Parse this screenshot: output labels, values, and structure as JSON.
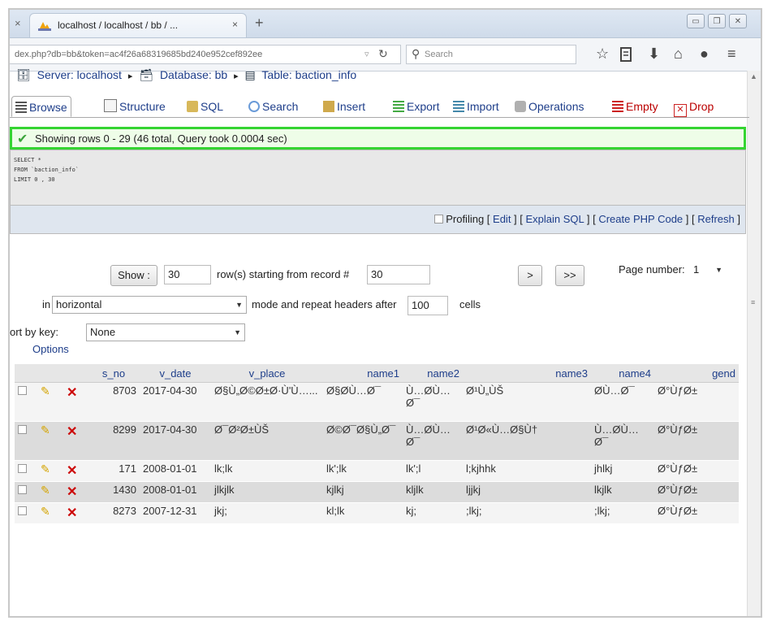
{
  "browser": {
    "prev_tab_close": "×",
    "tab_title": "localhost / localhost / bb / ...",
    "tab_close": "×",
    "new_tab": "+",
    "url": "dex.php?db=bb&token=ac4f26a68319685bd240e952cef892ee",
    "search_placeholder": "Search",
    "win_min": "▭",
    "win_max": "❐",
    "win_close": "✕"
  },
  "breadcrumb": {
    "server": "Server: localhost",
    "database": "Database: bb",
    "table": "Table: baction_info",
    "sep": "▸"
  },
  "tabs": [
    {
      "label": "Browse"
    },
    {
      "label": "Structure"
    },
    {
      "label": "SQL"
    },
    {
      "label": "Search"
    },
    {
      "label": "Insert"
    },
    {
      "label": "Export"
    },
    {
      "label": "Import"
    },
    {
      "label": "Operations"
    },
    {
      "label": "Empty"
    },
    {
      "label": "Drop"
    }
  ],
  "status": {
    "message": "Showing rows 0 - 29 (46 total, Query took 0.0004 sec)"
  },
  "sql": {
    "query": "SELECT *\nFROM `baction_info`\nLIMIT 0 , 30"
  },
  "sql_links": {
    "profiling": "Profiling",
    "edit": "Edit",
    "explain": "Explain SQL",
    "php": "Create PHP Code",
    "refresh": "Refresh"
  },
  "nav": {
    "show_label": "Show :",
    "rows_value": "30",
    "rows_text": "row(s) starting from record #",
    "start_value": "30",
    "next": ">",
    "last": ">>",
    "page_label": "Page number:",
    "page_value": "1",
    "in_label": "in",
    "mode_value": "horizontal",
    "mode_text": "mode and repeat headers after",
    "repeat_value": "100",
    "cells_text": "cells",
    "sort_label": "ort by key:",
    "sort_value": "None",
    "options": "Options"
  },
  "table": {
    "columns": [
      "s_no",
      "v_date",
      "v_place",
      "name1",
      "name2",
      "name3",
      "name4",
      "gend"
    ],
    "rows": [
      {
        "s_no": "8703",
        "v_date": "2017-04-30",
        "v_place": "Ø§Ù„Ø©Ø±Ø·Ù'Ù…...",
        "name1": "Ø§ØÙ…Ø¯",
        "name2": "Ù…Ø­Ù…Ø¯",
        "name3": "Ø¹Ù„ÙŠ",
        "name4": "Ø­Ù…Ø¯",
        "gend": "Ø°ÙƒØ±"
      },
      {
        "s_no": "8299",
        "v_date": "2017-04-30",
        "v_place": "Ø¯Ø²Ø±ÙŠ",
        "name1": "Ø©Ø¯Ø§Ù„Ø¯",
        "name2": "Ù…Ø­Ù…Ø¯",
        "name3": "Ø¹Ø«Ù…Ø§Ù†",
        "name4": "Ù…Ø­Ù…Ø¯",
        "gend": "Ø°ÙƒØ±"
      },
      {
        "s_no": "171",
        "v_date": "2008-01-01",
        "v_place": "lk;lk",
        "name1": "lk';lk",
        "name2": "lk';l",
        "name3": "l;kjhhk",
        "name4": "jhlkj",
        "gend": "Ø°ÙƒØ±"
      },
      {
        "s_no": "1430",
        "v_date": "2008-01-01",
        "v_place": "jlkjlk",
        "name1": "kjlkj",
        "name2": "kljlk",
        "name3": "ljjkj",
        "name4": "lkjlk",
        "gend": "Ø°ÙƒØ±"
      },
      {
        "s_no": "8273",
        "v_date": "2007-12-31",
        "v_place": "jkj;",
        "name1": "kl;lk",
        "name2": "kj;",
        "name3": ";lkj;",
        "name4": ";lkj;",
        "gend": "Ø°ÙƒØ±"
      }
    ]
  },
  "colors": {
    "link": "#1e3e8a",
    "success_border": "#35d432",
    "delete": "#cc0000",
    "edit": "#d4a400"
  }
}
